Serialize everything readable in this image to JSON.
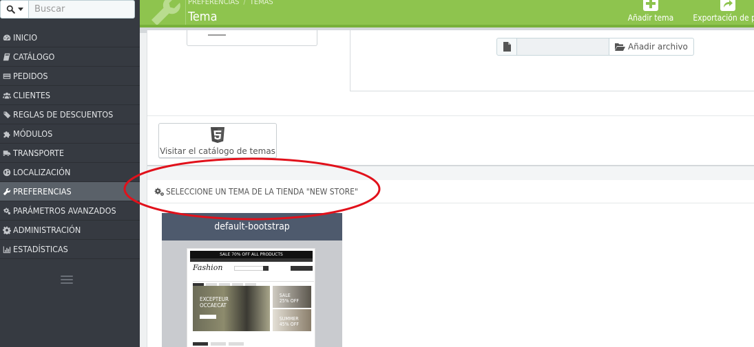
{
  "search": {
    "placeholder": "Buscar"
  },
  "sidebar": {
    "items": [
      {
        "label": "INICIO",
        "icon": "dashboard-icon"
      },
      {
        "label": "CATÁLOGO",
        "icon": "book-icon"
      },
      {
        "label": "PEDIDOS",
        "icon": "credit-card-icon"
      },
      {
        "label": "CLIENTES",
        "icon": "users-icon"
      },
      {
        "label": "REGLAS DE DESCUENTOS",
        "icon": "tags-icon"
      },
      {
        "label": "MÓDULOS",
        "icon": "puzzle-icon"
      },
      {
        "label": "TRANSPORTE",
        "icon": "truck-icon"
      },
      {
        "label": "LOCALIZACIÓN",
        "icon": "globe-icon"
      },
      {
        "label": "PREFERENCIAS",
        "icon": "wrench-icon",
        "active": true
      },
      {
        "label": "PARÁMETROS AVANZADOS",
        "icon": "cogs-icon"
      },
      {
        "label": "ADMINISTRACIÓN",
        "icon": "cog-icon"
      },
      {
        "label": "ESTADÍSTICAS",
        "icon": "bar-chart-icon"
      }
    ]
  },
  "header": {
    "breadcrumb": [
      "PREFERENCIAS",
      "TEMAS"
    ],
    "title": "Tema",
    "toolbar": {
      "add_theme_label": "Añadir tema",
      "export_label": "Exportación de pla"
    }
  },
  "upload": {
    "button_label": "Añadir archivo"
  },
  "catalog": {
    "visit_label": "Visitar el catálogo de temas"
  },
  "themes_section": {
    "title": "SELECCIONE UN TEMA DE LA TIENDA \"NEW STORE\"",
    "theme_name": "default-bootstrap",
    "preview": {
      "banner": "SALE 70% OFF ALL PRODUCTS",
      "logo": "Fashion",
      "hero_text_1": "EXCEPTEUR",
      "hero_text_2": "OCCAECAT",
      "side_1_a": "SALE",
      "side_1_b": "25% OFF",
      "side_2_a": "SUMMER",
      "side_2_b": "45% OFF"
    }
  },
  "colors": {
    "header_green": "#8ec44e",
    "sidebar_dark": "#363a41",
    "sidebar_active": "#5a6169",
    "annotation_red": "#e1111b",
    "theme_card_header": "#4e5a6d"
  }
}
